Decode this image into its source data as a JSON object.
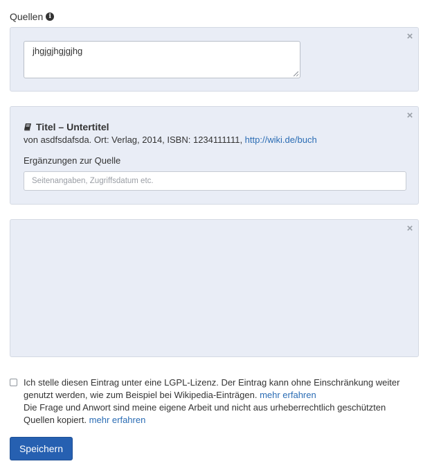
{
  "section": {
    "label": "Quellen",
    "info_icon": "info-circle"
  },
  "colors": {
    "panel_bg": "#e9edf6",
    "link": "#2a6cb4",
    "primary_button": "#2660b1"
  },
  "panels": {
    "free_text": {
      "value": "jhgjgjhgjgjhg",
      "close_label": "×"
    },
    "source": {
      "icon": "book-icon",
      "title": "Titel – Untertitel",
      "meta_text": "von asdfsdafsda. Ort: Verlag, 2014, ISBN: 1234111111, ",
      "link_text": "http://wiki.de/buch",
      "supplement_label": "Ergänzungen zur Quelle",
      "supplement_placeholder": "Seitenangaben, Zugriffsdatum etc.",
      "supplement_value": "",
      "close_label": "×"
    },
    "empty": {
      "close_label": "×"
    }
  },
  "license": {
    "checked": false,
    "line1": "Ich stelle diesen Eintrag unter eine LGPL-Lizenz. Der Eintrag kann ohne Einschränkung weiter genutzt werden, wie zum Beispiel bei Wikipedia-Einträgen. ",
    "link1": "mehr erfahren",
    "line2": "Die Frage und Anwort sind meine eigene Arbeit und nicht aus urheberrechtlich geschützten Quellen kopiert. ",
    "link2": "mehr erfahren"
  },
  "actions": {
    "save_label": "Speichern"
  }
}
